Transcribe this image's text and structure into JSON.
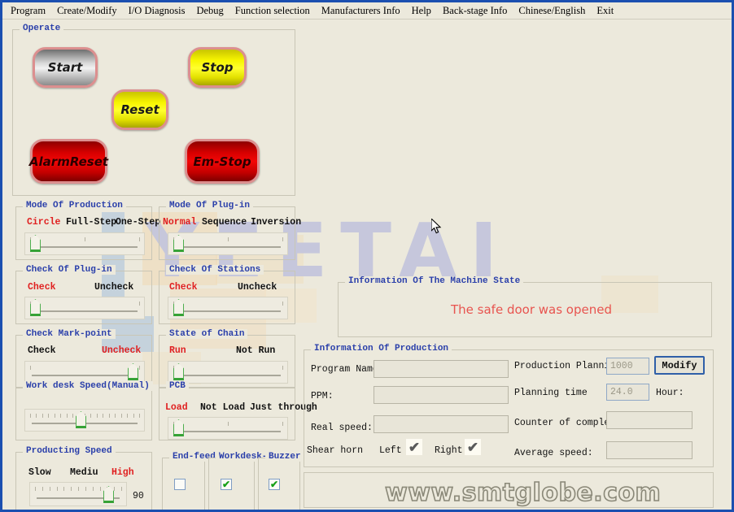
{
  "menubar": {
    "items": [
      {
        "label": "Program"
      },
      {
        "label": "Create/Modify"
      },
      {
        "label": "I/O Diagnosis"
      },
      {
        "label": "Debug"
      },
      {
        "label": "Function selection"
      },
      {
        "label": "Manufacturers Info"
      },
      {
        "label": "Help"
      },
      {
        "label": "Back-stage Info"
      },
      {
        "label": "Chinese/English"
      },
      {
        "label": "Exit"
      }
    ]
  },
  "watermark": {
    "brand": "YEETAI",
    "site": "www.smtglobe.com",
    "brand_color": "#c4c6dd"
  },
  "operate": {
    "legend": "Operate",
    "buttons": [
      {
        "label": "Start",
        "color": "grey"
      },
      {
        "label": "Stop",
        "color": "yellow"
      },
      {
        "label": "Reset",
        "color": "yellow"
      },
      {
        "label": "AlarmReset",
        "color": "red"
      },
      {
        "label": "Em-Stop",
        "color": "red"
      }
    ]
  },
  "mode_production": {
    "legend": "Mode Of Production",
    "options": [
      "Circle",
      "Full-Step",
      "One-Step"
    ],
    "selected": "Circle",
    "slider_value": 0
  },
  "mode_plugin": {
    "legend": "Mode Of Plug-in",
    "options": [
      "Normal",
      "Sequence",
      "Inversion"
    ],
    "selected": "Normal",
    "slider_value": 0
  },
  "check_plugin": {
    "legend": "Check Of Plug-in",
    "options": [
      "Check",
      "Uncheck"
    ],
    "selected": "Check",
    "slider_value": 0
  },
  "check_stations": {
    "legend": "Check Of Stations",
    "options": [
      "Check",
      "Uncheck"
    ],
    "selected": "Check",
    "slider_value": 0
  },
  "check_markpoint": {
    "legend": "Check Mark-point",
    "options": [
      "Check",
      "Uncheck"
    ],
    "selected": "Uncheck",
    "slider_value": 100
  },
  "state_chain": {
    "legend": "State of Chain",
    "options": [
      "Run",
      "Not Run"
    ],
    "selected": "Run",
    "slider_value": 0
  },
  "workdesk_speed": {
    "legend": "Work desk Speed(Manual)",
    "slider_value": 45
  },
  "pcb": {
    "legend": "PCB",
    "options": [
      "Load",
      "Not Load",
      "Just through"
    ],
    "selected": "Load",
    "slider_value": 0
  },
  "producting_speed": {
    "legend": "Producting Speed",
    "options": [
      "Slow",
      "Mediu",
      "High"
    ],
    "selected": "High",
    "slider_value": 78,
    "value_display": "90"
  },
  "toggles": [
    {
      "legend": "End-feed",
      "checked": false,
      "mark": ""
    },
    {
      "legend": "Workdesk-lev",
      "checked": true,
      "mark": "✔"
    },
    {
      "legend": "Buzzer",
      "checked": true,
      "mark": "✔"
    }
  ],
  "machine_state": {
    "legend": "Information Of The Machine State",
    "message": "The safe door was opened",
    "message_color": "#e8544f"
  },
  "production_info": {
    "legend": "Information Of Production",
    "fields_left": [
      {
        "label": "Program Name:",
        "value": ""
      },
      {
        "label": "PPM:",
        "value": ""
      },
      {
        "label": "Real speed:",
        "value": ""
      }
    ],
    "fields_right": [
      {
        "label": "Production Planning",
        "value": "1000"
      },
      {
        "label": "Planning time",
        "value": "24.0",
        "suffix": "Hour:"
      },
      {
        "label": "Counter of complete:",
        "value": ""
      },
      {
        "label": "Average speed:",
        "value": ""
      }
    ],
    "modify_button": "Modify",
    "shear_horn": {
      "label": "Shear horn",
      "left_label": "Left",
      "left_mark": "✔",
      "right_label": "Right",
      "right_mark": "✔"
    }
  }
}
